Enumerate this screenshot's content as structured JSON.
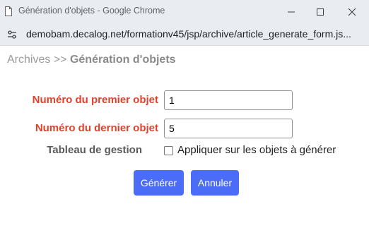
{
  "window": {
    "title": "Génération d'objets - Google Chrome",
    "icons": {
      "app": "document-icon",
      "minimize": "minimize-icon",
      "maximize": "maximize-icon",
      "close": "close-icon"
    }
  },
  "address_bar": {
    "url": "demobam.decalog.net/formationv45/jsp/archive/article_generate_form.js...",
    "site_icon": "site-settings-icon"
  },
  "breadcrumb": {
    "parent": "Archives",
    "separator": ">>",
    "current": "Génération d'objets"
  },
  "form": {
    "first_label": "Numéro du premier objet",
    "first_value": "1",
    "last_label": "Numéro du dernier objet",
    "last_value": "5",
    "grid_label": "Tableau de gestion",
    "apply_label": "Appliquer sur les objets à générer",
    "apply_checked": false
  },
  "buttons": {
    "generate": "Générer",
    "cancel": "Annuler"
  },
  "colors": {
    "required_label": "#e0402c",
    "button": "#4a6cf7",
    "chrome_bg": "#e9ecf1"
  }
}
